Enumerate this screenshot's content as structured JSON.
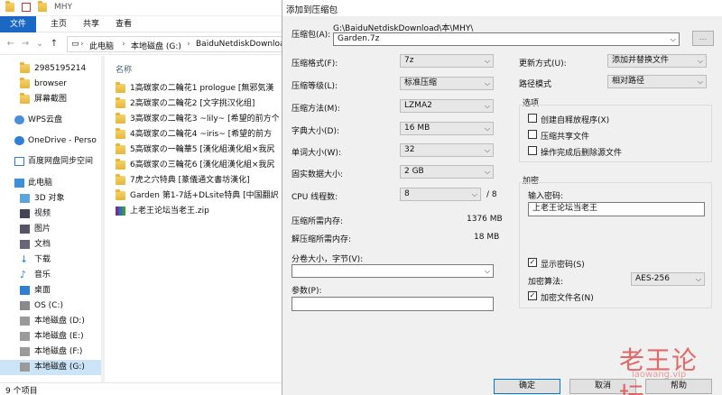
{
  "explorer": {
    "window_title": "MHY",
    "ribbon_tabs": [
      "文件",
      "主页",
      "共享",
      "查看"
    ],
    "breadcrumb": [
      "此电脑",
      "本地磁盘 (G:)",
      "BaiduNetdiskDownload"
    ],
    "nav_items": [
      {
        "label": "2985195214",
        "icon": "folder-icon"
      },
      {
        "label": "browser",
        "icon": "folder-icon"
      },
      {
        "label": "屏幕截图",
        "icon": "folder-icon"
      },
      {
        "label": "WPS云盘",
        "icon": "cloud-icon"
      },
      {
        "label": "OneDrive - Perso",
        "icon": "cloud-icon"
      },
      {
        "label": "百度网盘同步空间",
        "icon": "baidu-icon"
      },
      {
        "label": "此电脑",
        "icon": "pc-icon"
      },
      {
        "label": "3D 对象",
        "icon": "cube-icon"
      },
      {
        "label": "视频",
        "icon": "video-icon"
      },
      {
        "label": "图片",
        "icon": "picture-icon"
      },
      {
        "label": "文档",
        "icon": "document-icon"
      },
      {
        "label": "下载",
        "icon": "download-icon"
      },
      {
        "label": "音乐",
        "icon": "music-icon"
      },
      {
        "label": "桌面",
        "icon": "desktop-icon"
      },
      {
        "label": "OS (C:)",
        "icon": "drive-icon"
      },
      {
        "label": "本地磁盘 (D:)",
        "icon": "drive-icon"
      },
      {
        "label": "本地磁盘 (E:)",
        "icon": "drive-icon"
      },
      {
        "label": "本地磁盘 (F:)",
        "icon": "drive-icon"
      },
      {
        "label": "本地磁盘 (G:)",
        "icon": "drive-icon"
      }
    ],
    "column_header": "名称",
    "files": [
      {
        "name": "1高碳家の二輪花1 prologue [無邪気漢",
        "type": "folder"
      },
      {
        "name": "2高碳家の二輪花2 [文字挑汉化组]",
        "type": "folder"
      },
      {
        "name": "3高碳家の二輪花3 ~lily~ [希望的前方个",
        "type": "folder"
      },
      {
        "name": "4高碳家の二輪花4 ~iris~ [希望的前方",
        "type": "folder"
      },
      {
        "name": "5高碳家の一輪華5 [漢化組漢化組×我尻",
        "type": "folder"
      },
      {
        "name": "6高碳家の三輪花6 [漢化組漢化組×我尻",
        "type": "folder"
      },
      {
        "name": "7虎之穴特典 [篆儀通文書坊漢化]",
        "type": "folder"
      },
      {
        "name": "Garden 第1-7話+DLsite特典 [中国翻訳",
        "type": "folder"
      },
      {
        "name": "上老王论坛当老王.zip",
        "type": "zip"
      }
    ],
    "status": "9 个项目"
  },
  "dialog": {
    "title": "添加到压缩包",
    "archive_label": "压缩包(A):",
    "archive_path": "G:\\BaiduNetdiskDownload\\本\\MHY\\",
    "archive_name": "Garden.7z",
    "browse_label": "...",
    "left_fields": [
      {
        "label": "压缩格式(F):",
        "value": "7z"
      },
      {
        "label": "压缩等级(L):",
        "value": "标准压缩"
      },
      {
        "label": "压缩方法(M):",
        "value": "LZMA2"
      },
      {
        "label": "字典大小(D):",
        "value": "16 MB"
      },
      {
        "label": "单词大小(W):",
        "value": "32"
      },
      {
        "label": "固实数据大小:",
        "value": "2 GB"
      },
      {
        "label": "CPU 线程数:",
        "value": "8",
        "suffix": "/ 8"
      }
    ],
    "mem_compress_label": "压缩所需内存:",
    "mem_compress_value": "1376 MB",
    "mem_decompress_label": "解压缩所需内存:",
    "mem_decompress_value": "18 MB",
    "split_label": "分卷大小，字节(V):",
    "split_value": "",
    "params_label": "参数(P):",
    "params_value": "",
    "update_label": "更新方式(U):",
    "update_value": "添加并替换文件",
    "path_label": "路径模式",
    "path_value": "相对路径",
    "options_title": "选项",
    "options": [
      {
        "label": "创建自释放程序(X)",
        "checked": false
      },
      {
        "label": "压缩共享文件",
        "checked": false
      },
      {
        "label": "操作完成后删除源文件",
        "checked": false
      }
    ],
    "encrypt_title": "加密",
    "password_label": "输入密码:",
    "password_value": "上老王论坛当老王",
    "show_password_label": "显示密码(S)",
    "show_password_checked": true,
    "enc_method_label": "加密算法:",
    "enc_method_value": "AES-256",
    "encrypt_names_label": "加密文件名(N)",
    "encrypt_names_checked": true,
    "ok_label": "确定",
    "cancel_label": "取消",
    "help_label": "帮助",
    "watermark": "老王论坛",
    "watermark_sub": "laowang.vip"
  }
}
